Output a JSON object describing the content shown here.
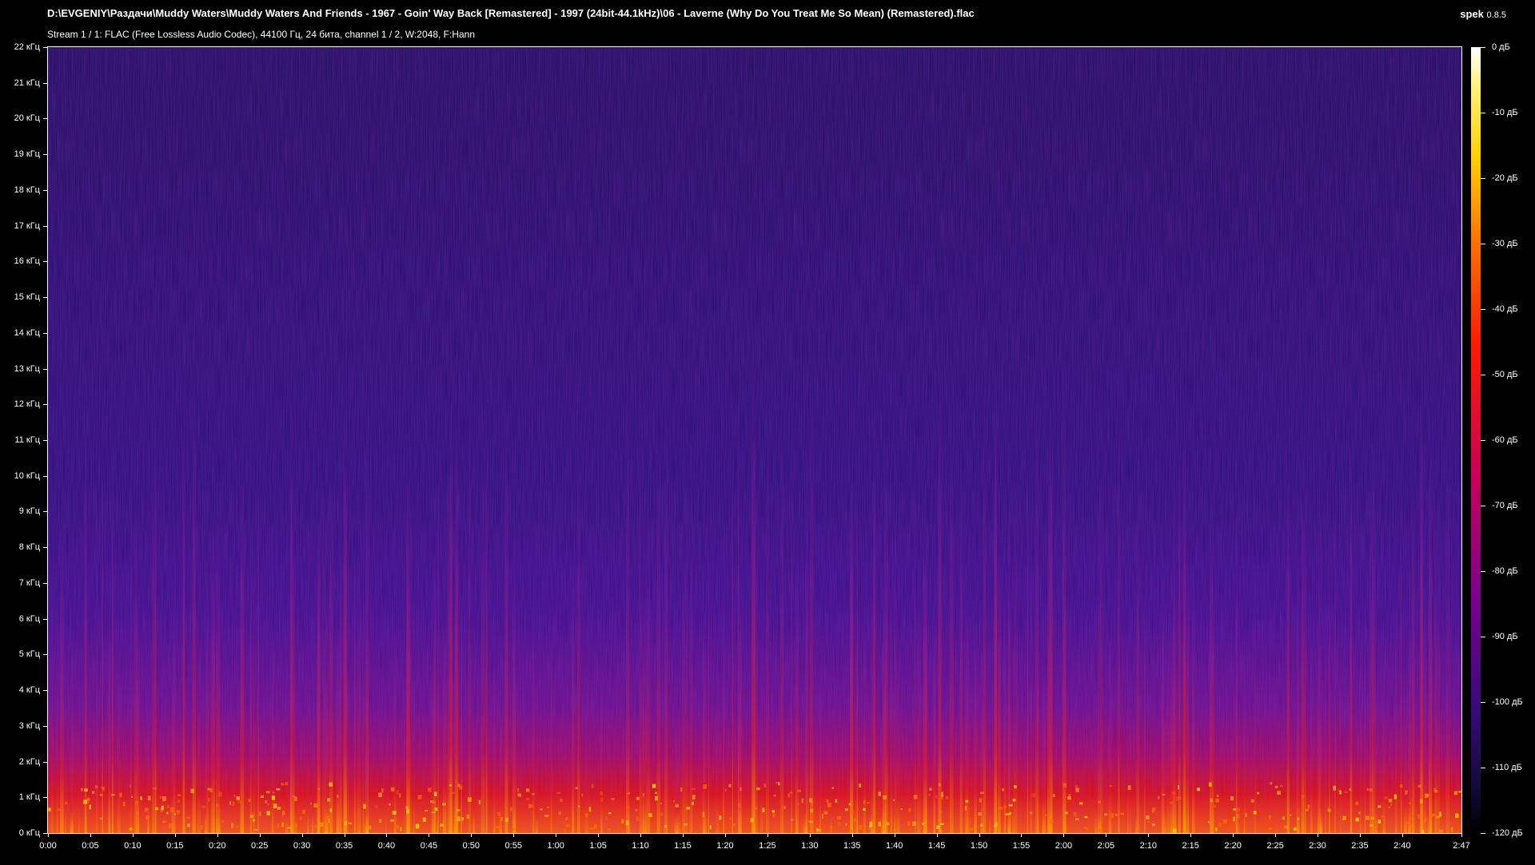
{
  "window": {
    "file_path": "D:\\EVGENIY\\Раздачи\\Muddy Waters\\Muddy Waters And Friends - 1967 - Goin' Way Back [Remastered] - 1997 (24bit-44.1kHz)\\06 - Laverne (Why Do You Treat Me So Mean) (Remastered).flac",
    "stream_info": "Stream 1 / 1: FLAC (Free Lossless Audio Codec), 44100 Гц, 24 бита, channel 1 / 2, W:2048, F:Hann",
    "app_name": "spek",
    "app_version": "0.8.5"
  },
  "freq_axis": [
    "22 кГц",
    "21 кГц",
    "20 кГц",
    "19 кГц",
    "18 кГц",
    "17 кГц",
    "16 кГц",
    "15 кГц",
    "14 кГц",
    "13 кГц",
    "12 кГц",
    "11 кГц",
    "10 кГц",
    "9 кГц",
    "8 кГц",
    "7 кГц",
    "6 кГц",
    "5 кГц",
    "4 кГц",
    "3 кГц",
    "2 кГц",
    "1 кГц",
    "0 кГц"
  ],
  "time_axis": [
    "0:00",
    "0:05",
    "0:10",
    "0:15",
    "0:20",
    "0:25",
    "0:30",
    "0:35",
    "0:40",
    "0:45",
    "0:50",
    "0:55",
    "1:00",
    "1:05",
    "1:10",
    "1:15",
    "1:20",
    "1:25",
    "1:30",
    "1:35",
    "1:40",
    "1:45",
    "1:50",
    "1:55",
    "2:00",
    "2:05",
    "2:10",
    "2:15",
    "2:20",
    "2:25",
    "2:30",
    "2:35",
    "2:40",
    "2:47"
  ],
  "db_scale": [
    "0 дБ",
    "-10 дБ",
    "-20 дБ",
    "-30 дБ",
    "-40 дБ",
    "-50 дБ",
    "-60 дБ",
    "-70 дБ",
    "-80 дБ",
    "-90 дБ",
    "-100 дБ",
    "-110 дБ",
    "-120 дБ"
  ],
  "colors": {
    "background": "#000000",
    "text": "#ffffff",
    "spectrogram_base": "#1a0b5a",
    "hot": "#ff1a00",
    "peak": "#ffd000"
  }
}
